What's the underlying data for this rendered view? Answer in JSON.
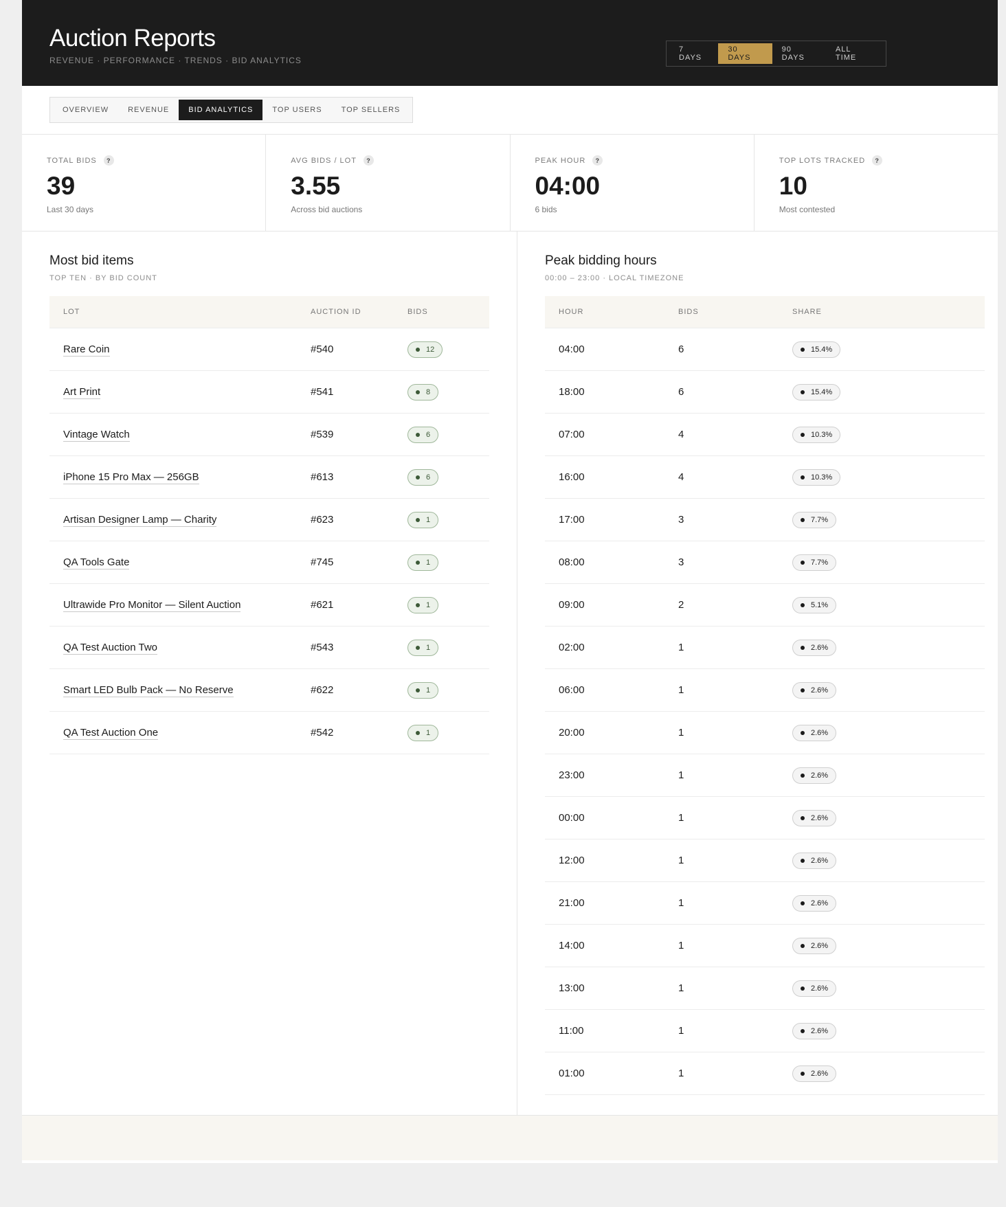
{
  "header": {
    "title": "Auction Reports",
    "subtitle": "REVENUE · PERFORMANCE · TRENDS · BID ANALYTICS",
    "ranges": [
      {
        "label": "7 DAYS",
        "active": false
      },
      {
        "label": "30 DAYS",
        "active": true
      },
      {
        "label": "90 DAYS",
        "active": false
      },
      {
        "label": "ALL TIME",
        "active": false
      }
    ]
  },
  "tabs": [
    {
      "label": "OVERVIEW",
      "active": false
    },
    {
      "label": "REVENUE",
      "active": false
    },
    {
      "label": "BID ANALYTICS",
      "active": true
    },
    {
      "label": "TOP USERS",
      "active": false
    },
    {
      "label": "TOP SELLERS",
      "active": false
    }
  ],
  "kpis": [
    {
      "label": "TOTAL BIDS",
      "help": "?",
      "value": "39",
      "caption": "Last 30 days"
    },
    {
      "label": "AVG BIDS / LOT",
      "help": "?",
      "value": "3.55",
      "caption": "Across bid auctions"
    },
    {
      "label": "PEAK HOUR",
      "help": "?",
      "value": "04:00",
      "caption": "6 bids"
    },
    {
      "label": "TOP LOTS TRACKED",
      "help": "?",
      "value": "10",
      "caption": "Most contested"
    }
  ],
  "most_bid": {
    "title": "Most bid items",
    "subtitle": "TOP TEN · BY BID COUNT",
    "columns": [
      "LOT",
      "AUCTION ID",
      "BIDS"
    ],
    "rows": [
      {
        "lot": "Rare Coin",
        "auction_id": "#540",
        "bids": "12"
      },
      {
        "lot": "Art Print",
        "auction_id": "#541",
        "bids": "8"
      },
      {
        "lot": "Vintage Watch",
        "auction_id": "#539",
        "bids": "6"
      },
      {
        "lot": "iPhone 15 Pro Max — 256GB",
        "auction_id": "#613",
        "bids": "6"
      },
      {
        "lot": "Artisan Designer Lamp — Charity",
        "auction_id": "#623",
        "bids": "1"
      },
      {
        "lot": "QA Tools Gate",
        "auction_id": "#745",
        "bids": "1"
      },
      {
        "lot": "Ultrawide Pro Monitor — Silent Auction",
        "auction_id": "#621",
        "bids": "1"
      },
      {
        "lot": "QA Test Auction Two",
        "auction_id": "#543",
        "bids": "1"
      },
      {
        "lot": "Smart LED Bulb Pack — No Reserve",
        "auction_id": "#622",
        "bids": "1"
      },
      {
        "lot": "QA Test Auction One",
        "auction_id": "#542",
        "bids": "1"
      }
    ]
  },
  "peak_hours": {
    "title": "Peak bidding hours",
    "subtitle": "00:00 – 23:00 · LOCAL TIMEZONE",
    "columns": [
      "HOUR",
      "BIDS",
      "SHARE"
    ],
    "rows": [
      {
        "hour": "04:00",
        "bids": "6",
        "share": "15.4%"
      },
      {
        "hour": "18:00",
        "bids": "6",
        "share": "15.4%"
      },
      {
        "hour": "07:00",
        "bids": "4",
        "share": "10.3%"
      },
      {
        "hour": "16:00",
        "bids": "4",
        "share": "10.3%"
      },
      {
        "hour": "17:00",
        "bids": "3",
        "share": "7.7%"
      },
      {
        "hour": "08:00",
        "bids": "3",
        "share": "7.7%"
      },
      {
        "hour": "09:00",
        "bids": "2",
        "share": "5.1%"
      },
      {
        "hour": "02:00",
        "bids": "1",
        "share": "2.6%"
      },
      {
        "hour": "06:00",
        "bids": "1",
        "share": "2.6%"
      },
      {
        "hour": "20:00",
        "bids": "1",
        "share": "2.6%"
      },
      {
        "hour": "23:00",
        "bids": "1",
        "share": "2.6%"
      },
      {
        "hour": "00:00",
        "bids": "1",
        "share": "2.6%"
      },
      {
        "hour": "12:00",
        "bids": "1",
        "share": "2.6%"
      },
      {
        "hour": "21:00",
        "bids": "1",
        "share": "2.6%"
      },
      {
        "hour": "14:00",
        "bids": "1",
        "share": "2.6%"
      },
      {
        "hour": "13:00",
        "bids": "1",
        "share": "2.6%"
      },
      {
        "hour": "11:00",
        "bids": "1",
        "share": "2.6%"
      },
      {
        "hour": "01:00",
        "bids": "1",
        "share": "2.6%"
      }
    ]
  },
  "colors": {
    "header_bg": "#1c1c1c",
    "accent_gold": "#c19a4d",
    "pill_green": "#3d5a38",
    "table_head_bg": "#f8f6f1"
  }
}
